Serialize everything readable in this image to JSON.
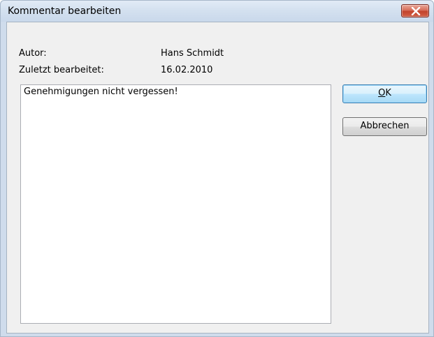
{
  "window": {
    "title": "Kommentar bearbeiten",
    "close_icon": "close-icon"
  },
  "fields": {
    "author_label": "Autor:",
    "author_value": "Hans Schmidt",
    "edited_label": "Zuletzt bearbeitet:",
    "edited_value": "16.02.2010"
  },
  "comment": {
    "text": "Genehmigungen nicht vergessen!"
  },
  "buttons": {
    "ok_mnemonic": "O",
    "ok_rest": "K",
    "cancel_label": "Abbrechen"
  },
  "colors": {
    "close_button": "#c2432c",
    "default_button_border": "#3c7fb1",
    "title_bar": "#d3e0ef"
  }
}
